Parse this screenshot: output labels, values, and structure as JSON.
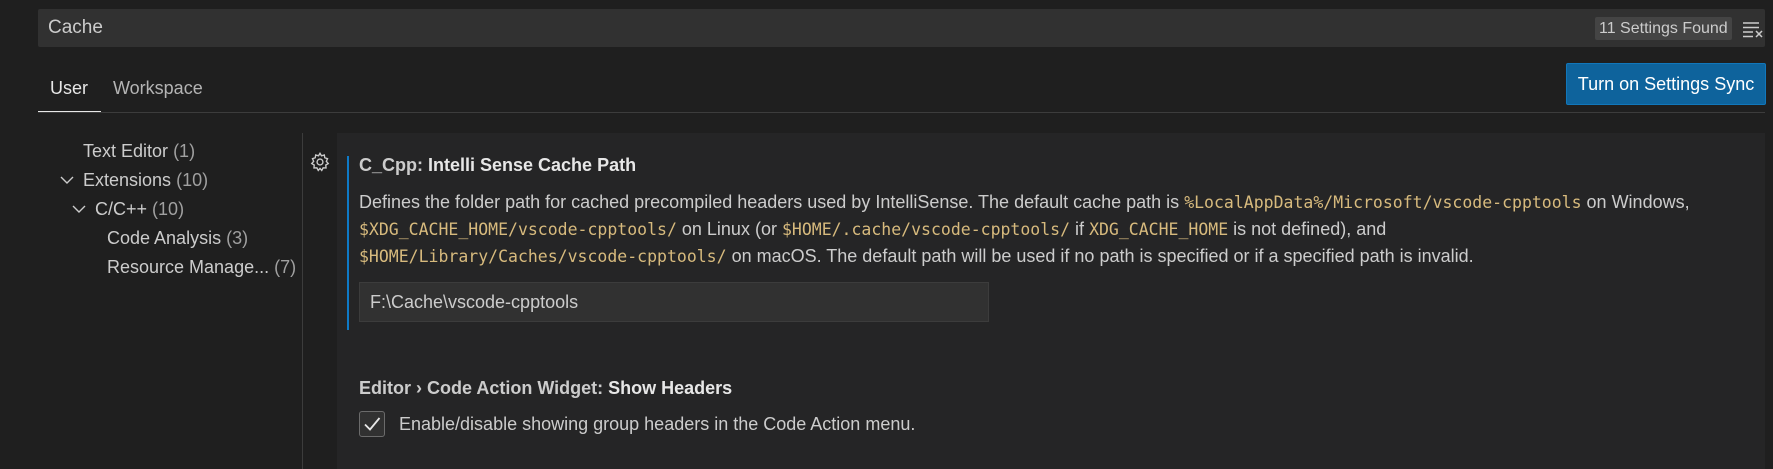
{
  "search": {
    "value": "Cache",
    "results_count": "11 Settings Found"
  },
  "tabs": [
    {
      "label": "User",
      "active": true
    },
    {
      "label": "Workspace",
      "active": false
    }
  ],
  "sync_button": {
    "label": "Turn on Settings Sync"
  },
  "toc": [
    {
      "label": "Text Editor",
      "count": "(1)",
      "expanded": null
    },
    {
      "label": "Extensions",
      "count": "(10)",
      "expanded": true
    },
    {
      "label": "C/C++",
      "count": "(10)",
      "expanded": true
    },
    {
      "label": "Code Analysis",
      "count": "(3)",
      "expanded": null
    },
    {
      "label": "Resource Manage...",
      "count": "(7)",
      "expanded": null
    }
  ],
  "settings": [
    {
      "category": "C_Cpp: ",
      "name": "Intelli Sense Cache Path",
      "description_parts": [
        "Defines the folder path for cached precompiled headers used by IntelliSense. The default cache path is ",
        "%LocalAppData%/Microsoft/vscode-cpptools",
        " on Windows, ",
        "$XDG_CACHE_HOME/vscode-cpptools/",
        " on Linux (or ",
        "$HOME/.cache/vscode-cpptools/",
        " if ",
        "XDG_CACHE_HOME",
        " is not defined), and ",
        "$HOME/Library/Caches/vscode-cpptools/",
        " on macOS. The default path will be used if no path is specified or if a specified path is invalid."
      ],
      "value": "F:\\Cache\\vscode-cpptools"
    },
    {
      "category": "Editor › Code Action Widget: ",
      "name": "Show Headers",
      "checkbox_checked": true,
      "checkbox_label": "Enable/disable showing group headers in the Code Action menu."
    }
  ],
  "colors": {
    "background": "#1f1f1f",
    "accent": "#0e639c",
    "focus": "#0e7ac7",
    "code": "#d7ba7d"
  },
  "icons": [
    "clear-filter-icon",
    "filter-icon",
    "chevron-down-icon",
    "gear-icon",
    "check-icon"
  ]
}
